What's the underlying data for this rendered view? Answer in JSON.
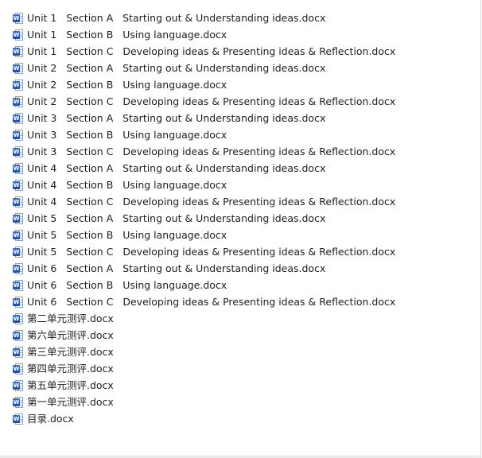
{
  "files": [
    {
      "name": "Unit 1   Section A   Starting out & Understanding ideas.docx",
      "icon": "word-document-icon"
    },
    {
      "name": "Unit 1   Section B   Using language.docx",
      "icon": "word-document-icon"
    },
    {
      "name": "Unit 1   Section C   Developing ideas & Presenting ideas & Reflection.docx",
      "icon": "word-document-icon"
    },
    {
      "name": "Unit 2   Section A   Starting out & Understanding ideas.docx",
      "icon": "word-document-icon"
    },
    {
      "name": "Unit 2   Section B   Using language.docx",
      "icon": "word-document-icon"
    },
    {
      "name": "Unit 2   Section C   Developing ideas & Presenting ideas & Reflection.docx",
      "icon": "word-document-icon"
    },
    {
      "name": "Unit 3   Section A   Starting out & Understanding ideas.docx",
      "icon": "word-document-icon"
    },
    {
      "name": "Unit 3   Section B   Using language.docx",
      "icon": "word-document-icon"
    },
    {
      "name": "Unit 3   Section C   Developing ideas & Presenting ideas & Reflection.docx",
      "icon": "word-document-icon"
    },
    {
      "name": "Unit 4   Section A   Starting out & Understanding ideas.docx",
      "icon": "word-document-icon"
    },
    {
      "name": "Unit 4   Section B   Using language.docx",
      "icon": "word-document-icon"
    },
    {
      "name": "Unit 4   Section C   Developing ideas & Presenting ideas & Reflection.docx",
      "icon": "word-document-icon"
    },
    {
      "name": "Unit 5   Section A   Starting out & Understanding ideas.docx",
      "icon": "word-document-icon"
    },
    {
      "name": "Unit 5   Section B   Using language.docx",
      "icon": "word-document-icon"
    },
    {
      "name": "Unit 5   Section C   Developing ideas & Presenting ideas & Reflection.docx",
      "icon": "word-document-icon"
    },
    {
      "name": "Unit 6   Section A   Starting out & Understanding ideas.docx",
      "icon": "word-document-icon"
    },
    {
      "name": "Unit 6   Section B   Using language.docx",
      "icon": "word-document-icon"
    },
    {
      "name": "Unit 6   Section C   Developing ideas & Presenting ideas & Reflection.docx",
      "icon": "word-document-icon"
    },
    {
      "name": "第二单元测评.docx",
      "icon": "word-document-icon"
    },
    {
      "name": "第六单元测评.docx",
      "icon": "word-document-icon"
    },
    {
      "name": "第三单元测评.docx",
      "icon": "word-document-icon"
    },
    {
      "name": "第四单元测评.docx",
      "icon": "word-document-icon"
    },
    {
      "name": "第五单元测评.docx",
      "icon": "word-document-icon"
    },
    {
      "name": "第一单元测评.docx",
      "icon": "word-document-icon"
    },
    {
      "name": "目录.docx",
      "icon": "word-document-icon"
    }
  ],
  "icon_badge_letter": "W",
  "colors": {
    "background": "#ffffff",
    "text": "#1e1e1e",
    "word_icon": "#2b5bb5"
  }
}
